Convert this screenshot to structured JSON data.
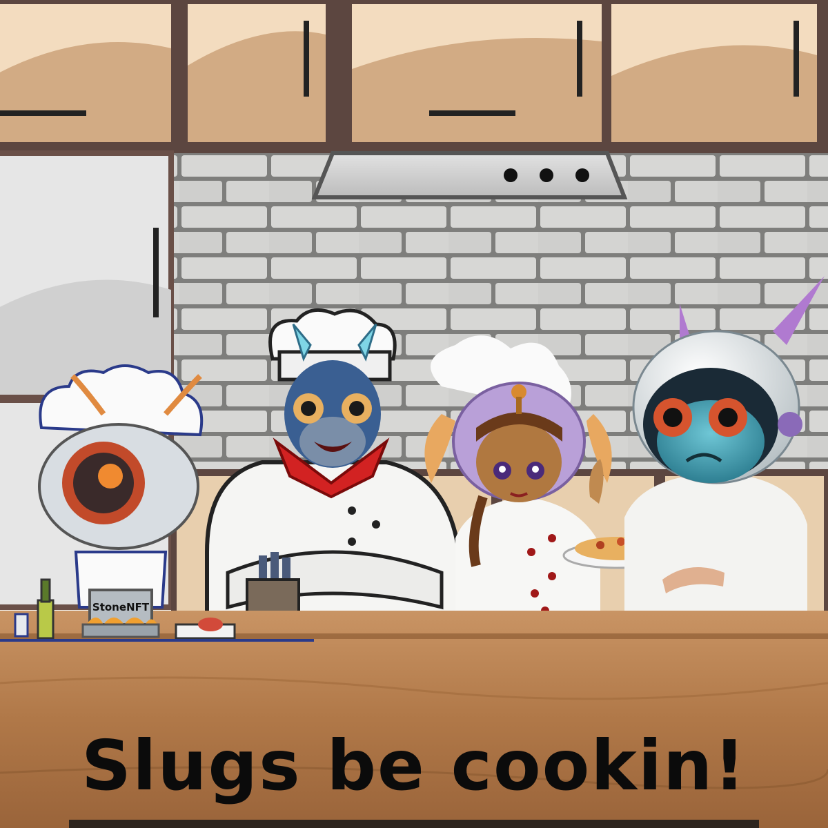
{
  "scene": {
    "description_free": true,
    "caption": "Slugs be cookin!",
    "pot_label": "StoneNFT"
  },
  "colors": {
    "cabinet": "#f2d8b8",
    "cabinet_shade": "#c89f78",
    "cabinet_frame": "#6a5048",
    "brick": "#d4d4d2",
    "mortar": "#9a9a98",
    "counter": "#b8824c",
    "counter_dark": "#8a5a30",
    "chef_white": "#f5f5f3",
    "scarf_red": "#d22222"
  }
}
